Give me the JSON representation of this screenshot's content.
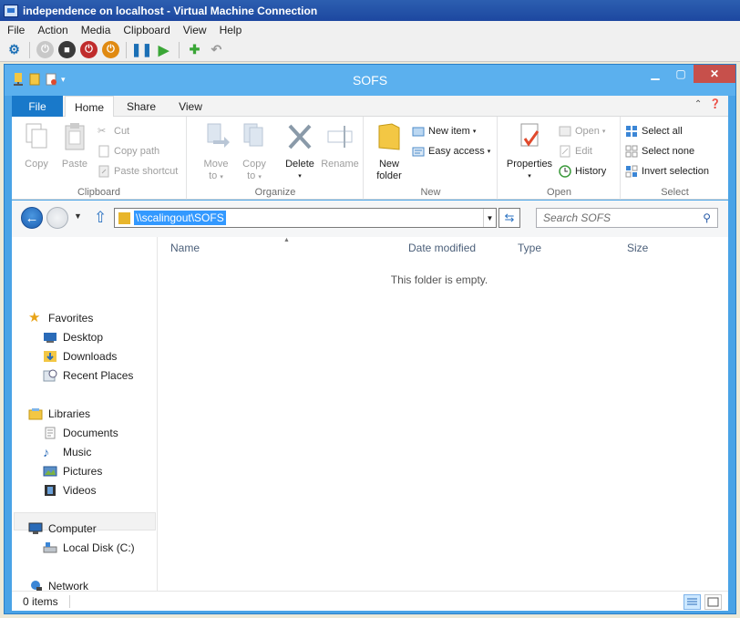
{
  "vm": {
    "title": "independence on localhost - Virtual Machine Connection",
    "menu": [
      "File",
      "Action",
      "Media",
      "Clipboard",
      "View",
      "Help"
    ],
    "toolbar_icons": [
      "ctrl-alt-del-icon",
      "start-icon",
      "turn-off-icon",
      "shutdown-icon",
      "power-icon",
      "pause-icon",
      "resume-icon",
      "checkpoint-icon",
      "revert-icon"
    ]
  },
  "explorer": {
    "title": "SOFS",
    "tabs": {
      "file": "File",
      "home": "Home",
      "share": "Share",
      "view": "View"
    },
    "ribbon": {
      "clipboard": {
        "label": "Clipboard",
        "copy": "Copy",
        "paste": "Paste",
        "cut": "Cut",
        "copy_path": "Copy path",
        "paste_shortcut": "Paste shortcut"
      },
      "organize": {
        "label": "Organize",
        "move_to_1": "Move",
        "move_to_2": "to",
        "copy_to_1": "Copy",
        "copy_to_2": "to",
        "delete": "Delete",
        "rename": "Rename"
      },
      "new": {
        "label": "New",
        "new_folder_1": "New",
        "new_folder_2": "folder",
        "new_item": "New item",
        "easy_access": "Easy access"
      },
      "open": {
        "label": "Open",
        "properties": "Properties",
        "open": "Open",
        "edit": "Edit",
        "history": "History"
      },
      "select": {
        "label": "Select",
        "select_all": "Select all",
        "select_none": "Select none",
        "invert_selection": "Invert selection"
      }
    },
    "address": "\\\\scalingout\\SOFS",
    "search_placeholder": "Search SOFS",
    "nav": {
      "favorites": "Favorites",
      "desktop": "Desktop",
      "downloads": "Downloads",
      "recent": "Recent Places",
      "libraries": "Libraries",
      "documents": "Documents",
      "music": "Music",
      "pictures": "Pictures",
      "videos": "Videos",
      "computer": "Computer",
      "local_disk": "Local Disk (C:)",
      "network": "Network"
    },
    "columns": {
      "name": "Name",
      "date": "Date modified",
      "type": "Type",
      "size": "Size"
    },
    "empty_message": "This folder is empty.",
    "status": {
      "items": "0 items"
    }
  }
}
